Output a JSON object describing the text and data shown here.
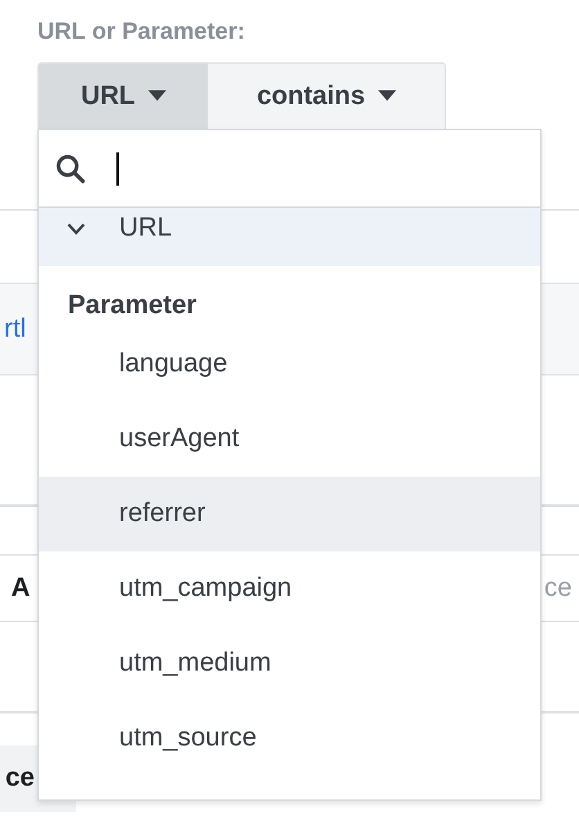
{
  "filter_label": "URL or Parameter:",
  "selectors": [
    {
      "label": "URL",
      "open": true
    },
    {
      "label": "contains",
      "open": false
    }
  ],
  "background": {
    "link": "rtl",
    "row_label": "A",
    "row_value": "ce",
    "button": "ce"
  },
  "dropdown": {
    "items": [
      {
        "kind": "option",
        "label": "URL",
        "checked": true,
        "hovered": false
      },
      {
        "kind": "header",
        "label": "Parameter"
      },
      {
        "kind": "option",
        "label": "language",
        "checked": false,
        "hovered": false
      },
      {
        "kind": "option",
        "label": "userAgent",
        "checked": false,
        "hovered": false
      },
      {
        "kind": "option",
        "label": "referrer",
        "checked": false,
        "hovered": true
      },
      {
        "kind": "option",
        "label": "utm_campaign",
        "checked": false,
        "hovered": false
      },
      {
        "kind": "option",
        "label": "utm_medium",
        "checked": false,
        "hovered": false
      },
      {
        "kind": "option",
        "label": "utm_source",
        "checked": false,
        "hovered": false
      }
    ]
  }
}
